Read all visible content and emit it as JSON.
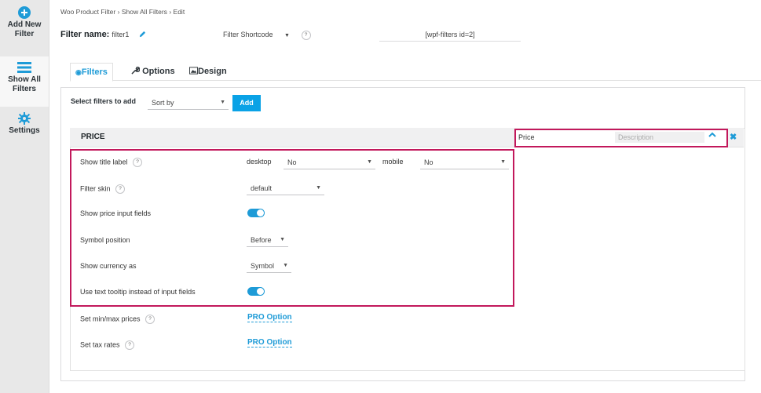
{
  "sidebar": {
    "items": [
      {
        "label": "Add New Filter",
        "icon": "plus-circle-icon"
      },
      {
        "label": "Show All Filters",
        "icon": "list-icon"
      },
      {
        "label": "Settings",
        "icon": "gear-icon"
      }
    ]
  },
  "breadcrumb": {
    "items": [
      "Woo Product Filter",
      "Show All Filters",
      "Edit"
    ],
    "separator": "›"
  },
  "filter_name": {
    "label": "Filter name:",
    "value": "filter1"
  },
  "shortcode": {
    "selected": "Filter Shortcode",
    "value": "[wpf-filters id=2]"
  },
  "help_mark": "?",
  "tabs": [
    {
      "label": "Filters",
      "icon": "eye-icon",
      "active": true
    },
    {
      "label": "Options",
      "icon": "wrench-icon",
      "active": false
    },
    {
      "label": "Design",
      "icon": "image-icon",
      "active": false
    }
  ],
  "add_filter": {
    "label": "Select filters to add",
    "selected": "Sort by",
    "button": "Add"
  },
  "filter": {
    "title": "PRICE",
    "title_input_value": "Price",
    "description_placeholder": "Description",
    "options": {
      "show_title_label": {
        "label": "Show title label",
        "desktop_label": "desktop",
        "desktop_value": "No",
        "mobile_label": "mobile",
        "mobile_value": "No"
      },
      "filter_skin": {
        "label": "Filter skin",
        "value": "default"
      },
      "show_price_input_fields": {
        "label": "Show price input fields",
        "enabled": true
      },
      "symbol_position": {
        "label": "Symbol position",
        "value": "Before"
      },
      "show_currency_as": {
        "label": "Show currency as",
        "value": "Symbol"
      },
      "use_text_tooltip": {
        "label": "Use text tooltip instead of input fields",
        "enabled": true
      },
      "set_min_max_prices": {
        "label": "Set min/max prices",
        "value": "PRO Option"
      },
      "set_tax_rates": {
        "label": "Set tax rates",
        "value": "PRO Option"
      }
    }
  },
  "colors": {
    "accent": "#1e9bd7",
    "highlight": "#c2185b",
    "button": "#0aa2e6"
  },
  "arrow_glyph": "▼"
}
